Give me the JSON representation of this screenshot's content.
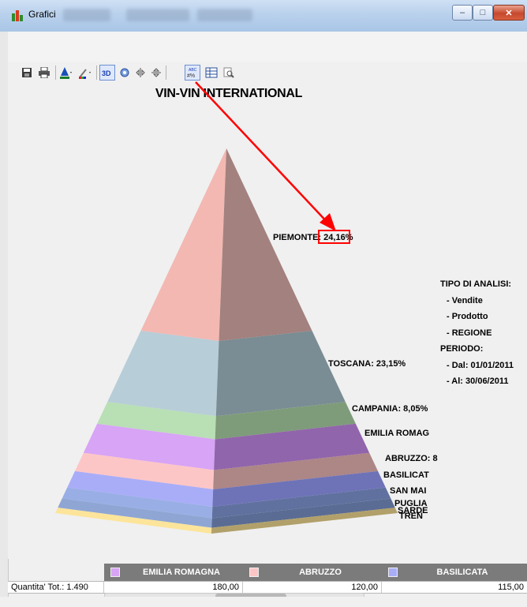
{
  "window": {
    "title": "Grafici",
    "icon": "bar-chart-icon",
    "controls": [
      "minimize-icon",
      "maximize-icon",
      "close-icon"
    ]
  },
  "toolbar": {
    "icons": [
      "save-icon",
      "print-icon",
      "color-icon",
      "palette-icon",
      "3d-icon",
      "rotate-icon",
      "flip-horizontal-icon",
      "flip-vertical-icon",
      "data-labels-icon",
      "data-table-icon",
      "zoom-icon"
    ]
  },
  "chart_data": {
    "type": "pyramid",
    "title": "VIN-VIN INTERNATIONAL",
    "labels_shown": [
      {
        "text": "PIEMONTE: 24,16%",
        "region": "PIEMONTE",
        "percent": 24.16
      },
      {
        "text": "TOSCANA: 23,15%",
        "region": "TOSCANA",
        "percent": 23.15
      },
      {
        "text": "CAMPANIA: 8,05%",
        "region": "CAMPANIA",
        "percent": 8.05
      },
      {
        "text": "EMILIA ROMAG",
        "region": "EMILIA ROMAGNA"
      },
      {
        "text": "ABRUZZO: 8",
        "region": "ABRUZZO"
      },
      {
        "text": "BASILICAT",
        "region": "BASILICATA"
      },
      {
        "text": "SAN MAI",
        "region": "SAN MARINO"
      },
      {
        "text": "PUGLIA",
        "region": "PUGLIA"
      },
      {
        "text": "SARDE",
        "region": "SARDEGNA"
      },
      {
        "text": "TREN",
        "region": "TRENTINO"
      }
    ],
    "segments": [
      {
        "name": "PIEMONTE",
        "color": "#f3b8b2",
        "shade": "#a3817e"
      },
      {
        "name": "TOSCANA",
        "color": "#b7cdd8",
        "shade": "#7a8c94"
      },
      {
        "name": "CAMPANIA",
        "color": "#b9dfb5",
        "shade": "#7e9c7a"
      },
      {
        "name": "EMILIA ROMAGNA",
        "color": "#d8a4f6",
        "shade": "#9165ab"
      },
      {
        "name": "ABRUZZO",
        "color": "#fdc6c6",
        "shade": "#ad8686"
      },
      {
        "name": "BASILICATA",
        "color": "#a9adf8",
        "shade": "#6e73b8"
      },
      {
        "name": "SAN MARINO",
        "color": "#9aaee6",
        "shade": "#60719f"
      },
      {
        "name": "PUGLIA",
        "color": "#8fa6d4",
        "shade": "#5a6c93"
      },
      {
        "name": "TRENTINO",
        "color": "#fce49a",
        "shade": "#b1a06a"
      }
    ]
  },
  "annotation": {
    "highlight_text": "24,16%",
    "color": "#ff0000"
  },
  "info_panel": {
    "tipo_label": "TIPO DI ANALISI:",
    "tipo_items": [
      "- Vendite",
      "- Prodotto",
      "- REGIONE"
    ],
    "periodo_label": "PERIODO:",
    "dal": "- Dal: 01/01/2011",
    "al": "- Al:  30/06/2011"
  },
  "data_grid": {
    "columns": [
      {
        "label": "EMILIA ROMAGNA",
        "color": "#d8a4f6",
        "value": "180,00"
      },
      {
        "label": "ABRUZZO",
        "color": "#fdc6c6",
        "value": "120,00"
      },
      {
        "label": "BASILICATA",
        "color": "#a9adf8",
        "value": "115,00"
      }
    ],
    "row_label": "Quantita' Tot.: 1.490"
  }
}
